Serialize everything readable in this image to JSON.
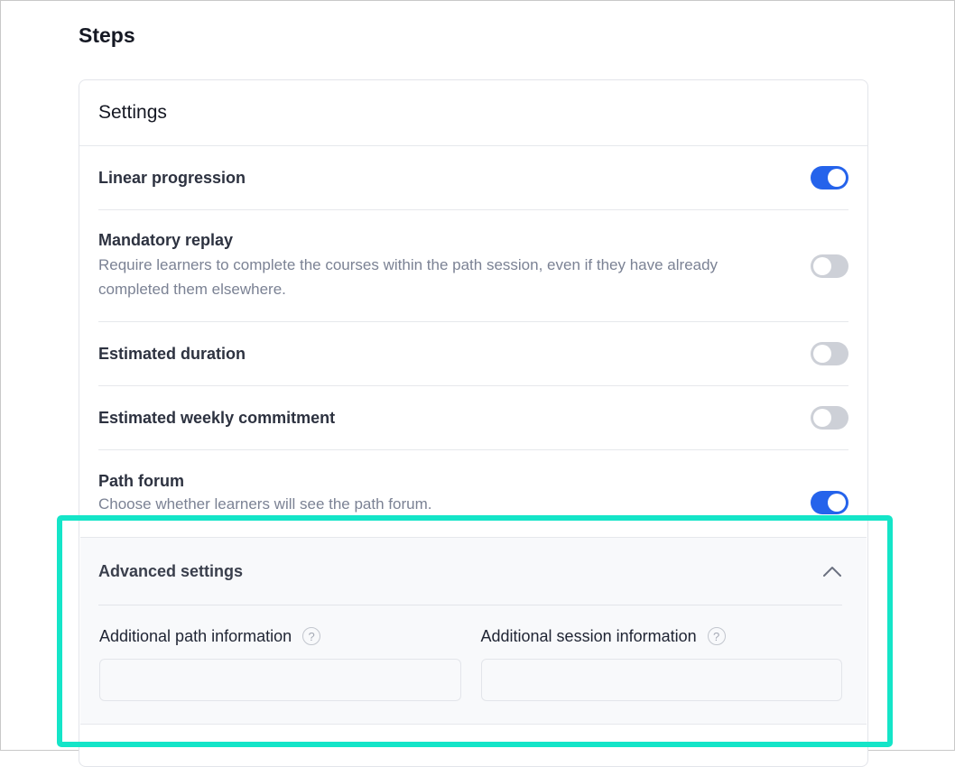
{
  "page": {
    "title": "Steps"
  },
  "settings": {
    "header": "Settings",
    "rows": [
      {
        "label": "Linear progression",
        "description": "",
        "enabled": true
      },
      {
        "label": "Mandatory replay",
        "description": "Require learners to complete the courses within the path session, even if they have already completed them elsewhere.",
        "enabled": false
      },
      {
        "label": "Estimated duration",
        "description": "",
        "enabled": false
      },
      {
        "label": "Estimated weekly commitment",
        "description": "",
        "enabled": false
      },
      {
        "label": "Path forum",
        "description": "Choose whether learners will see the path forum.",
        "enabled": true
      }
    ]
  },
  "advanced": {
    "title": "Advanced settings",
    "expanded": true,
    "fields": [
      {
        "label": "Additional path information",
        "help": "?",
        "value": "",
        "placeholder": ""
      },
      {
        "label": "Additional session information",
        "help": "?",
        "value": "",
        "placeholder": ""
      }
    ]
  },
  "colors": {
    "accent": "#2563eb",
    "toggle_off": "#cdd0d7",
    "highlight": "#14e5c8"
  }
}
